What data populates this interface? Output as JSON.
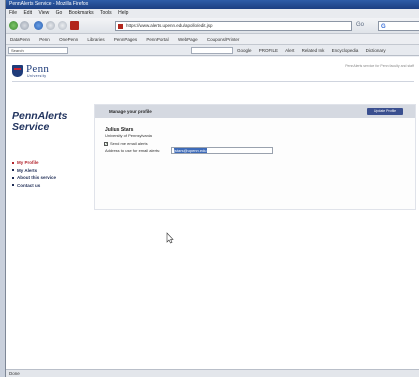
{
  "browser": {
    "title": "PennAlerts Service - Mozilla Firefox",
    "menu": [
      "File",
      "Edit",
      "View",
      "Go",
      "Bookmarks",
      "Tools",
      "Help"
    ],
    "url": "https://www.alerts.upenn.edu/apollo/edit.jsp",
    "go_label": "Go",
    "search_placeholder": "",
    "bookmarks": [
      "DataPenn",
      "Penn",
      "OnePenn",
      "Libraries",
      "PennPages",
      "PennPortal",
      "WebPage",
      "Coupons/Printer"
    ],
    "toolbar2_left": "Search",
    "toolbar2_links": [
      "Google",
      "PROFILE",
      "Alert",
      "Related Ink",
      "Encyclopedia",
      "Dictionary"
    ],
    "status": "Done"
  },
  "site": {
    "logo_word": "Penn",
    "logo_sub": "University",
    "tagline": "PennAlerts service for Penn faculty and staff"
  },
  "sidebar": {
    "app_name_line1": "PennAlerts",
    "app_name_line2": "Service",
    "items": [
      {
        "label": "My Profile",
        "active": true
      },
      {
        "label": "My Alerts",
        "active": false
      },
      {
        "label": "About this service",
        "active": false
      },
      {
        "label": "Contact us",
        "active": false
      }
    ]
  },
  "panel": {
    "title": "Manage your profile",
    "button_label": "Update Profile",
    "user_name": "Julius Stars",
    "user_org": "University of Pennsylvania",
    "checkbox_label": "Send me email alerts",
    "checkbox_checked": true,
    "address_label": "Address to use for email alerts:",
    "address_value": "jstars@upenn.edu"
  },
  "colors": {
    "accent": "#3a4f8f",
    "active_nav": "#b3262f",
    "brand_blue": "#1f3c7a"
  }
}
